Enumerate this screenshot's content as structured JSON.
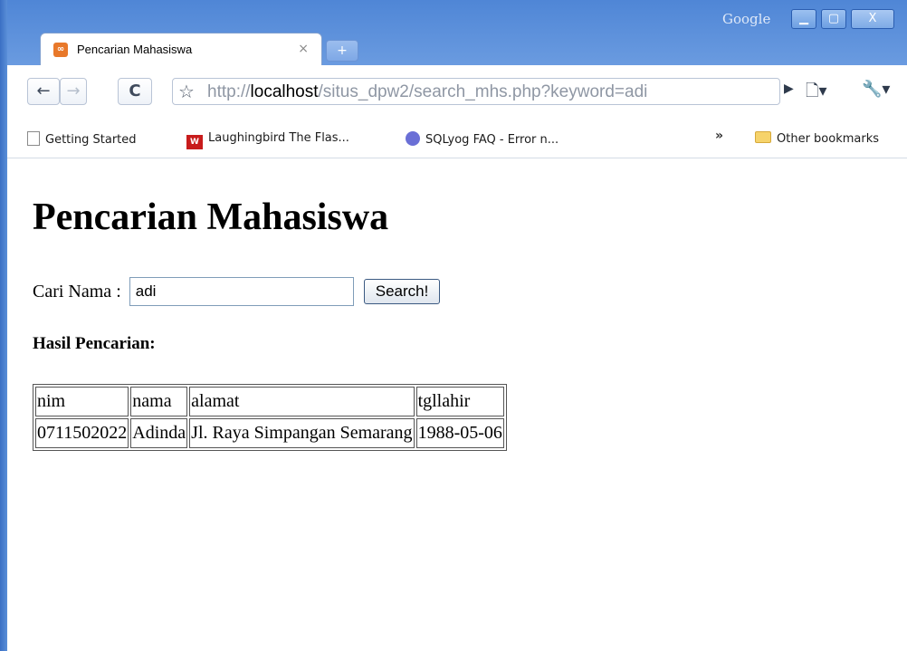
{
  "browser": {
    "google_label": "Google",
    "tab_title": "Pencarian Mahasiswa",
    "tab_close": "×",
    "newtab_symbol": "+",
    "url_prefix": "http://",
    "url_host": "localhost",
    "url_path": "/situs_dpw2/search_mhs.php?keyword=adi",
    "window_controls": {
      "minimize": "▁",
      "maximize": "▢",
      "close": "X"
    },
    "nav": {
      "back": "←",
      "forward": "→",
      "reload": "C",
      "star": "☆",
      "go": "▶",
      "page_menu": "🗋▾",
      "wrench": "🔧▾"
    }
  },
  "bookmarks": {
    "items": [
      {
        "label": "Getting Started",
        "icon": "page-icon"
      },
      {
        "label": "Laughingbird The Flas...",
        "icon": "wc-icon"
      },
      {
        "label": "SQLyog FAQ - Error n...",
        "icon": "sqlyog-icon"
      }
    ],
    "overflow": "»",
    "other": "Other bookmarks"
  },
  "page": {
    "title": "Pencarian Mahasiswa",
    "search_label": "Cari Nama :",
    "search_value": "adi",
    "search_button": "Search!",
    "result_heading": "Hasil Pencarian:",
    "table": {
      "headers": [
        "nim",
        "nama",
        "alamat",
        "tgllahir"
      ],
      "rows": [
        [
          "0711502022",
          "Adinda",
          "Jl. Raya Simpangan Semarang",
          "1988-05-06"
        ]
      ]
    }
  },
  "colors": {
    "titlebar": "#4f86d6",
    "accent": "#e8782a"
  }
}
